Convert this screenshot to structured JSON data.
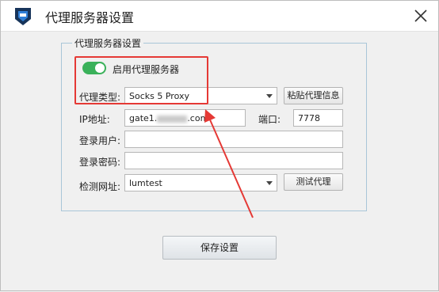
{
  "window": {
    "title": "代理服务器设置"
  },
  "group": {
    "legend": "代理服务器设置"
  },
  "enable": {
    "label": "启用代理服务器",
    "checked": true
  },
  "proxy_type": {
    "label": "代理类型:",
    "value": "Socks 5 Proxy"
  },
  "paste_button": {
    "label": "粘贴代理信息"
  },
  "ip": {
    "label": "IP地址:",
    "value_prefix": "gate1.",
    "value_suffix": ".com"
  },
  "port": {
    "label": "端口:",
    "value": "7778"
  },
  "username": {
    "label": "登录用户:",
    "value": ""
  },
  "password": {
    "label": "登录密码:",
    "value": ""
  },
  "check_url": {
    "label": "检测网址:",
    "value": "lumtest"
  },
  "test_button": {
    "label": "测试代理"
  },
  "save_button": {
    "label": "保存设置"
  },
  "annotation_color": "#e53935",
  "toggle_color": "#3ab15a"
}
